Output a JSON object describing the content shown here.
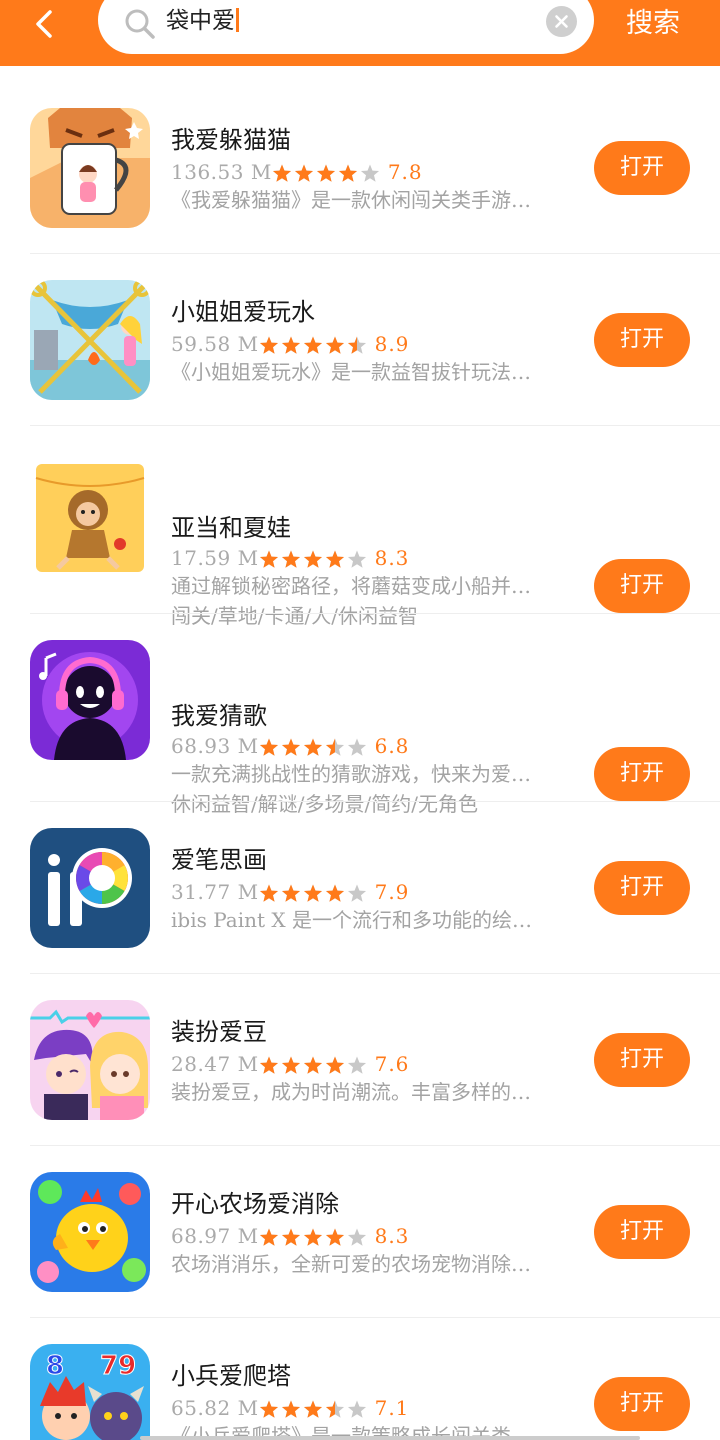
{
  "header": {
    "search_value": "袋中爱",
    "search_button_label": "搜索"
  },
  "colors": {
    "accent": "#ff7a1a",
    "star_empty": "#c8c8c8",
    "text_secondary": "#a3a3a3"
  },
  "apps": [
    {
      "name": "我爱躲猫猫",
      "size": "136.53 M",
      "rating": 7.8,
      "stars": 4,
      "score": "7.8",
      "description": "《我爱躲猫猫》是一款休闲闯关类手游…",
      "tags": "",
      "button": "打开",
      "icon": "cat-mug-game-icon"
    },
    {
      "name": "小姐姐爱玩水",
      "size": "59.58 M",
      "rating": 8.9,
      "stars": 4.5,
      "score": "8.9",
      "description": "《小姐姐爱玩水》是一款益智拔针玩法…",
      "tags": "",
      "button": "打开",
      "icon": "pin-puzzle-game-icon"
    },
    {
      "name": "亚当和夏娃",
      "size": "17.59 M",
      "rating": 8.3,
      "stars": 4,
      "score": "8.3",
      "description": "通过解锁秘密路径，将蘑菇变成小船并…",
      "tags": "闯关/草地/卡通/人/休闲益智",
      "button": "打开",
      "icon": "adam-eve-game-icon"
    },
    {
      "name": "我爱猜歌",
      "size": "68.93 M",
      "rating": 6.8,
      "stars": 3.5,
      "score": "6.8",
      "description": "一款充满挑战性的猜歌游戏，快来为爱…",
      "tags": "休闲益智/解谜/多场景/简约/无角色",
      "button": "打开",
      "icon": "music-guess-game-icon"
    },
    {
      "name": "爱笔思画",
      "size": "31.77 M",
      "rating": 7.9,
      "stars": 4,
      "score": "7.9",
      "description": "ibis Paint X 是一个流行和多功能的绘…",
      "tags": "",
      "button": "打开",
      "icon": "ibis-paint-icon"
    },
    {
      "name": "装扮爱豆",
      "size": "28.47 M",
      "rating": 7.6,
      "stars": 4,
      "score": "7.6",
      "description": "装扮爱豆，成为时尚潮流。丰富多样的…",
      "tags": "",
      "button": "打开",
      "icon": "dress-up-idol-icon"
    },
    {
      "name": "开心农场爱消除",
      "size": "68.97 M",
      "rating": 8.3,
      "stars": 4,
      "score": "8.3",
      "description": "农场消消乐，全新可爱的农场宠物消除…",
      "tags": "",
      "button": "打开",
      "icon": "farm-match-game-icon"
    },
    {
      "name": "小兵爱爬塔",
      "size": "65.82 M",
      "rating": 7.1,
      "stars": 3.5,
      "score": "7.1",
      "description": "《小兵爱爬塔》是一款策略成长闯关类…",
      "tags": "",
      "button": "打开",
      "icon": "tower-climb-game-icon"
    }
  ]
}
